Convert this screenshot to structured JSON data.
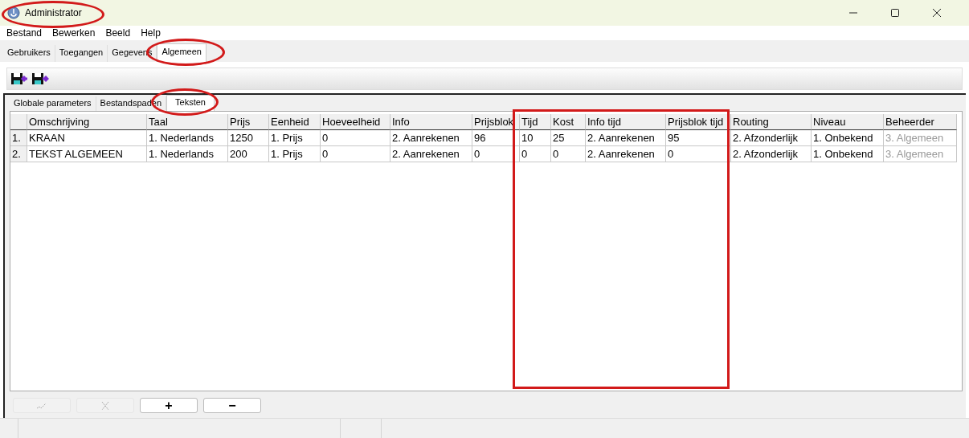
{
  "window": {
    "title": "Administrator"
  },
  "menu": [
    "Bestand",
    "Bewerken",
    "Beeld",
    "Help"
  ],
  "tabs": [
    {
      "label": "Gebruikers",
      "selected": false
    },
    {
      "label": "Toegangen",
      "selected": false
    },
    {
      "label": "Gegevens",
      "selected": false
    },
    {
      "label": "Algemeen",
      "selected": true
    }
  ],
  "subtabs": [
    {
      "label": "Globale parameters",
      "selected": false
    },
    {
      "label": "Bestandspaden",
      "selected": false
    },
    {
      "label": "Teksten",
      "selected": true
    }
  ],
  "table": {
    "columns": [
      {
        "label": "Omschrijving",
        "disabled": false
      },
      {
        "label": "Taal",
        "disabled": false
      },
      {
        "label": "Prijs",
        "disabled": false
      },
      {
        "label": "Eenheid",
        "disabled": false
      },
      {
        "label": "Hoeveelheid",
        "disabled": false
      },
      {
        "label": "Info",
        "disabled": false
      },
      {
        "label": "Prijsblok",
        "disabled": false
      },
      {
        "label": "Tijd",
        "disabled": false
      },
      {
        "label": "Kost",
        "disabled": false
      },
      {
        "label": "Info tijd",
        "disabled": false
      },
      {
        "label": "Prijsblok tijd",
        "disabled": false
      },
      {
        "label": "Routing",
        "disabled": false
      },
      {
        "label": "Niveau",
        "disabled": false
      },
      {
        "label": "Beheerder",
        "disabled": true
      }
    ],
    "rows": [
      {
        "number": "1.",
        "cells": [
          "KRAAN",
          "1. Nederlands",
          "1250",
          "1. Prijs",
          "0",
          "2. Aanrekenen",
          "96",
          "10",
          "25",
          "2. Aanrekenen",
          "95",
          "2. Afzonderlijk",
          "1. Onbekend",
          "3. Algemeen"
        ]
      },
      {
        "number": "2.",
        "cells": [
          "TEKST ALGEMEEN",
          "1. Nederlands",
          "200",
          "1. Prijs",
          "0",
          "2. Aanrekenen",
          "0",
          "0",
          "0",
          "2. Aanrekenen",
          "0",
          "2. Afzonderlijk",
          "1. Onbekend",
          "3. Algemeen"
        ]
      }
    ]
  },
  "buttons": [
    {
      "kind": "check",
      "disabled": true
    },
    {
      "kind": "cross",
      "disabled": true
    },
    {
      "kind": "text",
      "label": "+",
      "disabled": false
    },
    {
      "kind": "text",
      "label": "−",
      "disabled": false
    }
  ]
}
